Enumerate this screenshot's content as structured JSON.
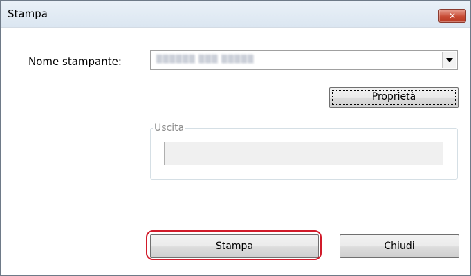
{
  "window": {
    "title": "Stampa",
    "close_icon": "close-icon",
    "close_glyph": "✕",
    "close_color": "#c74a33"
  },
  "printer": {
    "label": "Nome stampante:",
    "value": "▒▒▒▒▒▒ ▒▒▒ ▒▒▒▒▒",
    "dropdown_icon": "chevron-down-icon"
  },
  "buttons": {
    "properties": "Proprietà",
    "print": "Stampa",
    "close": "Chiudi"
  },
  "output_group": {
    "legend": "Uscita",
    "value": ""
  },
  "colors": {
    "highlight": "#d11b2a"
  }
}
